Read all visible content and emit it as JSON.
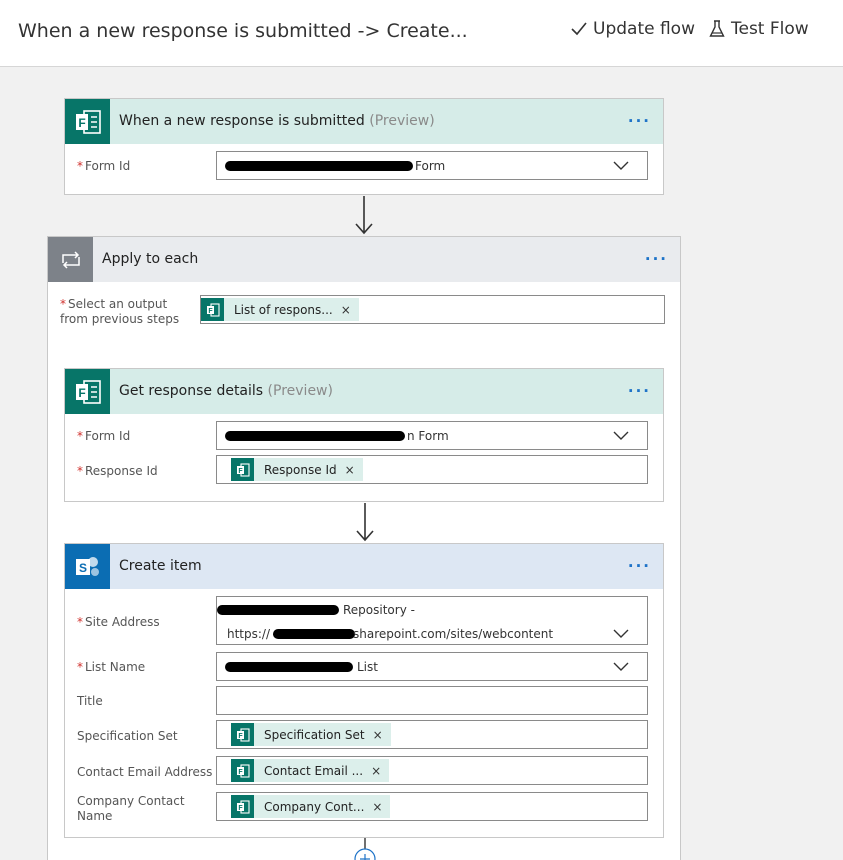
{
  "header": {
    "title": "When a new response is submitted -> Create...",
    "update_label": "Update flow",
    "test_label": "Test Flow"
  },
  "trigger": {
    "title": "When a new response is submitted",
    "preview": "(Preview)",
    "form_id_label": "Form Id",
    "form_id_value_visible": "Form"
  },
  "apply_each": {
    "title": "Apply to each",
    "select_label_1": "Select an output",
    "select_label_2": "from previous steps",
    "token_label": "List of respons..."
  },
  "get_details": {
    "title": "Get response details",
    "preview": "(Preview)",
    "form_id_label": "Form Id",
    "form_id_value_visible": "n Form",
    "response_id_label": "Response Id",
    "response_token": "Response Id"
  },
  "create_item": {
    "title": "Create item",
    "site_label": "Site Address",
    "site_value_line1_visible": "Repository -",
    "site_value_line2_prefix": "https://",
    "site_value_line2_suffix": "sharepoint.com/sites/webcontent",
    "list_label": "List Name",
    "list_value_visible": "List",
    "title_label": "Title",
    "spec_label": "Specification Set",
    "spec_token": "Specification Set",
    "email_label": "Contact Email Address",
    "email_token": "Contact Email ...",
    "company_label_1": "Company Contact",
    "company_label_2": "Name",
    "company_token": "Company Cont..."
  },
  "icons": {
    "forms": "forms-icon",
    "loop": "loop-icon",
    "sharepoint": "sharepoint-icon"
  },
  "colors": {
    "forms_green": "#077568",
    "forms_header": "#d6ece8",
    "sharepoint_blue": "#0b6db3",
    "link_blue": "#1e73c8",
    "required_red": "#d0312d"
  }
}
